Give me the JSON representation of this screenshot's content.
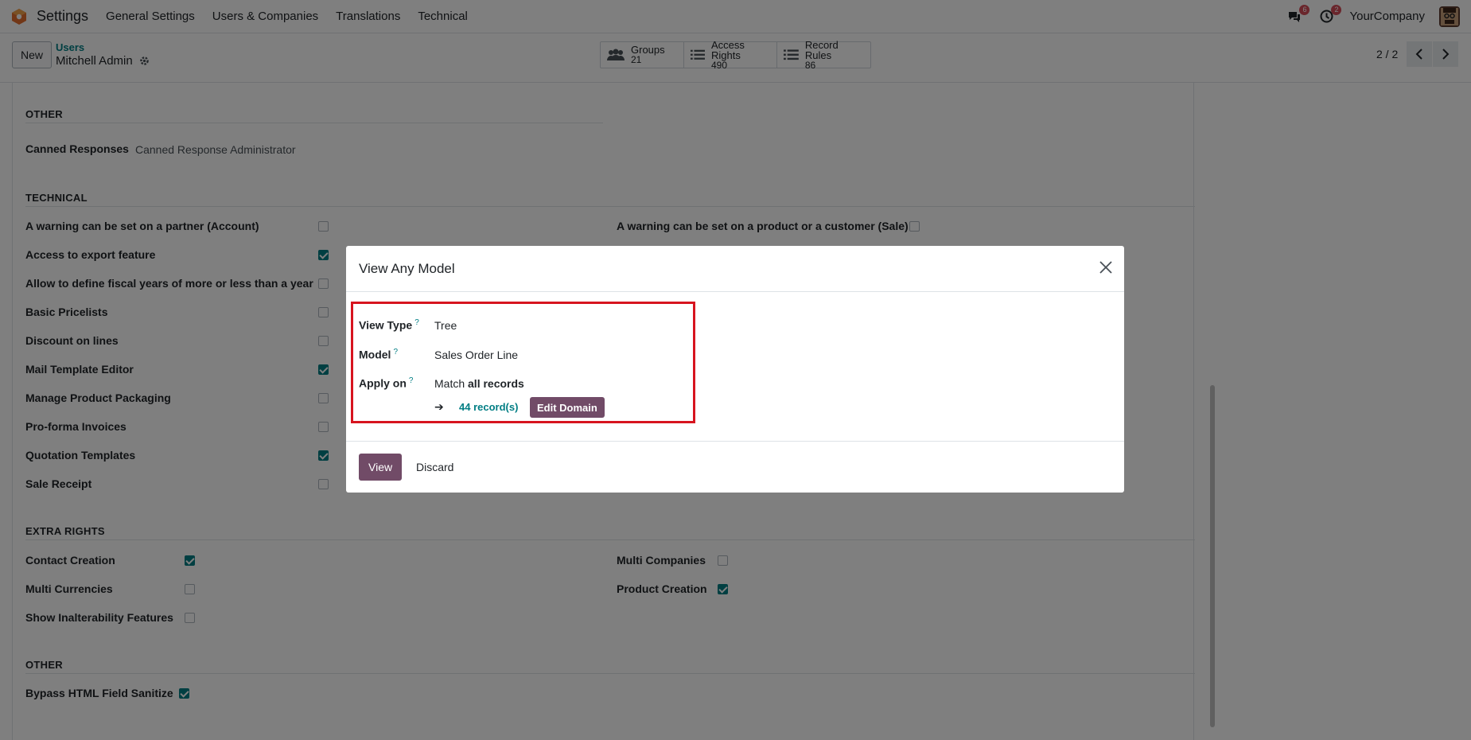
{
  "navbar": {
    "app_name": "Settings",
    "menu": [
      "General Settings",
      "Users & Companies",
      "Translations",
      "Technical"
    ],
    "chat_count": "6",
    "activity_count": "2",
    "company": "YourCompany"
  },
  "control_panel": {
    "new_label": "New",
    "breadcrumb_parent": "Users",
    "breadcrumb_current": "Mitchell Admin",
    "smart_buttons": [
      {
        "label": "Groups",
        "value": "21"
      },
      {
        "label": "Access Rights",
        "value": "490"
      },
      {
        "label": "Record Rules",
        "value": "86"
      }
    ],
    "pager": "2 / 2"
  },
  "form": {
    "other_top": {
      "title": "OTHER",
      "field_label": "Canned Responses",
      "field_value": "Canned Response Administrator"
    },
    "technical": {
      "title": "TECHNICAL",
      "left_items": [
        {
          "label": "A warning can be set on a partner (Account)",
          "checked": false
        },
        {
          "label": "Access to export feature",
          "checked": true
        },
        {
          "label": "Allow to define fiscal years of more or less than a year",
          "checked": false
        },
        {
          "label": "Basic Pricelists",
          "checked": false
        },
        {
          "label": "Discount on lines",
          "checked": false
        },
        {
          "label": "Mail Template Editor",
          "checked": true
        },
        {
          "label": "Manage Product Packaging",
          "checked": false
        },
        {
          "label": "Pro-forma Invoices",
          "checked": false
        },
        {
          "label": "Quotation Templates",
          "checked": true
        },
        {
          "label": "Sale Receipt",
          "checked": false
        }
      ],
      "right_items": [
        {
          "label": "A warning can be set on a product or a customer (Sale)",
          "checked": false
        }
      ]
    },
    "extra_rights": {
      "title": "EXTRA RIGHTS",
      "left_items": [
        {
          "label": "Contact Creation",
          "checked": true
        },
        {
          "label": "Multi Currencies",
          "checked": false
        },
        {
          "label": "Show Inalterability Features",
          "checked": false
        }
      ],
      "right_items": [
        {
          "label": "Multi Companies",
          "checked": false
        },
        {
          "label": "Product Creation",
          "checked": true
        }
      ]
    },
    "other_bottom": {
      "title": "OTHER",
      "items": [
        {
          "label": "Bypass HTML Field Sanitize",
          "checked": true
        }
      ]
    }
  },
  "modal": {
    "title": "View Any Model",
    "view_type_label": "View Type",
    "view_type_value": "Tree",
    "model_label": "Model",
    "model_value": "Sales Order Line",
    "apply_on_label": "Apply on",
    "help_mark": "?",
    "apply_on_prefix": "Match",
    "apply_on_bold": "all records",
    "arrow": "➔",
    "records_link": "44 record(s)",
    "edit_domain": "Edit Domain",
    "view_button": "View",
    "discard_button": "Discard"
  },
  "colors": {
    "brand": "#714b67",
    "accent": "#017e84",
    "highlight": "#d7141f"
  }
}
